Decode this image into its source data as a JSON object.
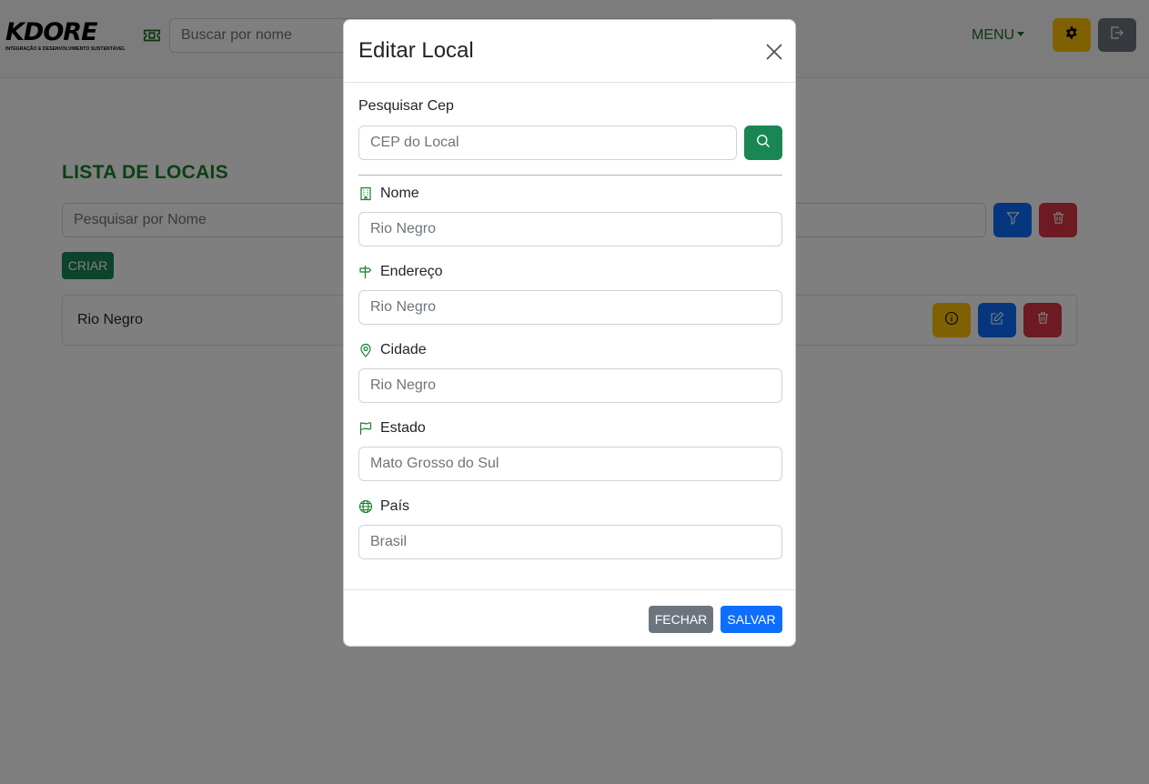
{
  "navbar": {
    "logo_text": "KDORE",
    "logo_subtitle": "INTEGRAÇÃO E DESENVOLVIMENTO SUSTENTÁVEL",
    "search_placeholder": "Buscar por nome",
    "menu_label": "MENU"
  },
  "page": {
    "title": "LISTA DE LOCAIS",
    "filter_placeholder": "Pesquisar por Nome",
    "create_label": "CRIAR",
    "items": [
      {
        "name": "Rio Negro"
      }
    ]
  },
  "modal": {
    "title": "Editar Local",
    "cep": {
      "label": "Pesquisar Cep",
      "placeholder": "CEP do Local"
    },
    "fields": {
      "nome": {
        "label": "Nome",
        "placeholder": "Rio Negro"
      },
      "endereco": {
        "label": "Endereço",
        "placeholder": "Rio Negro"
      },
      "cidade": {
        "label": "Cidade",
        "placeholder": "Rio Negro"
      },
      "estado": {
        "label": "Estado",
        "placeholder": "Mato Grosso do Sul"
      },
      "pais": {
        "label": "País",
        "placeholder": "Brasil"
      }
    },
    "close_label": "FECHAR",
    "save_label": "SALVAR"
  },
  "icons": {
    "ticket": "ticket-icon",
    "settings": "gear-icon",
    "logout": "logout-icon",
    "filter": "funnel-icon",
    "trash": "trash-icon",
    "info": "info-icon",
    "edit": "edit-icon",
    "search": "search-icon",
    "close": "close-icon",
    "building": "building-icon",
    "signpost": "signpost-icon",
    "location": "location-pin-icon",
    "flag": "flag-icon",
    "globe": "globe-icon"
  },
  "colors": {
    "brand_green": "#14802b",
    "success": "#198754",
    "primary": "#0d6efd",
    "danger": "#dc3545",
    "warning": "#ffc107",
    "secondary": "#6c757d"
  }
}
